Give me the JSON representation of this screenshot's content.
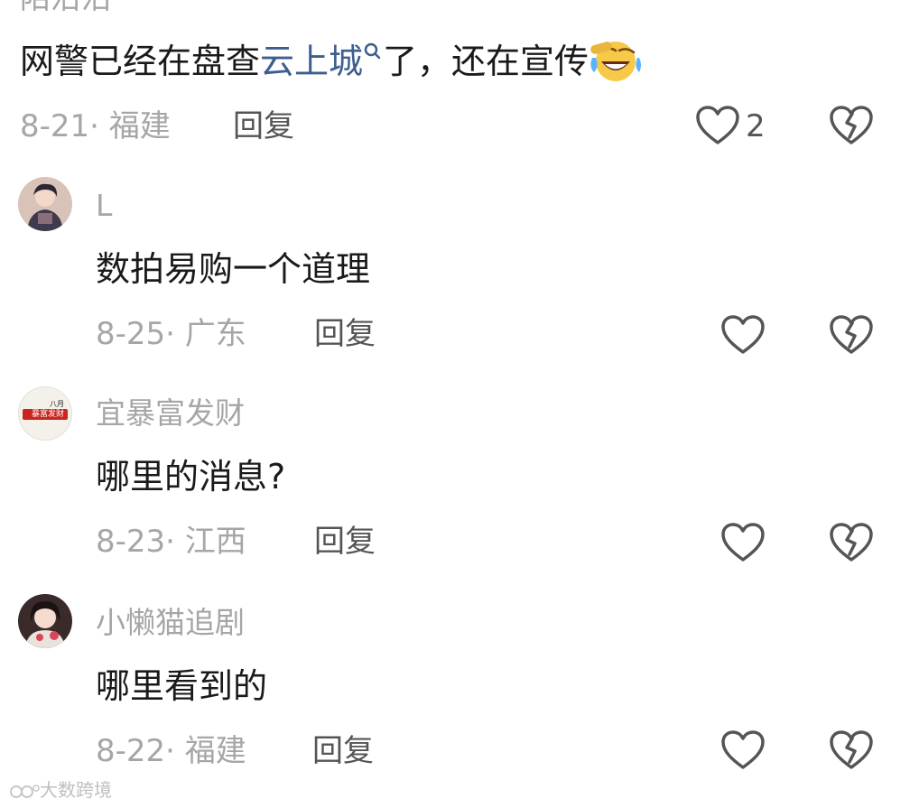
{
  "top_comment": {
    "username": "陌沿沿",
    "text_before": "网警已经在盘查",
    "link_text": "云上城",
    "text_after": "了，还在宣传",
    "emoji_name": "laughing-crying-emoji",
    "date_location": "8-21· 福建",
    "reply_label": "回复",
    "like_count": "2"
  },
  "replies": [
    {
      "username": "L",
      "text": "数拍易购一个道理",
      "date_location": "8-25· 广东",
      "reply_label": "回复",
      "avatar": "anime-boy-avatar"
    },
    {
      "username": "宜暴富发财",
      "text": "哪里的消息?",
      "date_location": "8-23· 江西",
      "reply_label": "回复",
      "avatar": "fortune-badge-avatar",
      "avatar_text_top": "八月",
      "avatar_text_main": "暴富发财"
    },
    {
      "username": "小懒猫追剧",
      "text": "哪里看到的",
      "date_location": "8-22· 福建",
      "reply_label": "回复",
      "avatar": "anime-girl-avatar"
    }
  ],
  "watermark": "大数跨境",
  "colors": {
    "link": "#3d5e8f",
    "meta": "#a6a6a6",
    "text": "#1a1a1a",
    "icon": "#555555"
  }
}
